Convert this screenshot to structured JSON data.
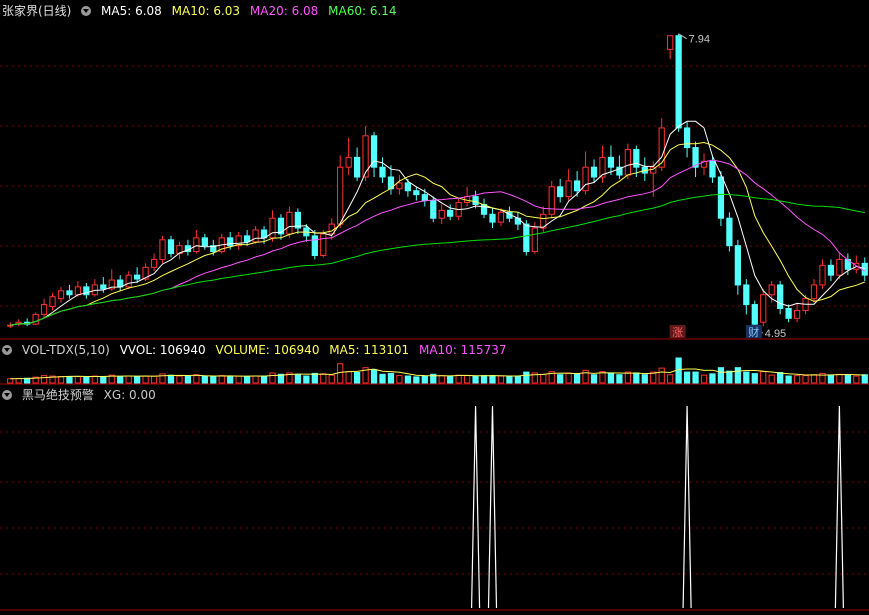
{
  "main": {
    "title": "张家界(日线)",
    "indicators": [
      {
        "label": "MA5: 6.08",
        "color": "#ffffff"
      },
      {
        "label": "MA10: 6.03",
        "color": "#ffff55"
      },
      {
        "label": "MA20: 6.08",
        "color": "#ff55ff"
      },
      {
        "label": "MA60: 6.14",
        "color": "#55ff55"
      }
    ],
    "high_label": "7.94",
    "low_label": "4.95",
    "marker_zhang": "涨",
    "marker_cai": "财"
  },
  "volume": {
    "title": "VOL-TDX(5,10)",
    "indicators": [
      {
        "label": "VVOL: 106940",
        "color": "#ffffff"
      },
      {
        "label": "VOLUME: 106940",
        "color": "#ffff55"
      },
      {
        "label": "MA5: 113101",
        "color": "#ffff55"
      },
      {
        "label": "MA10: 115737",
        "color": "#ff55ff"
      }
    ]
  },
  "signal": {
    "title": "黑马绝技预警",
    "indicators": [
      {
        "label": "XG: 0.00",
        "color": "#c8c8c8"
      }
    ]
  },
  "colors": {
    "up": "#ff3232",
    "down": "#54ffff",
    "ma5": "#ffffff",
    "ma10": "#ffff55",
    "ma20": "#ff55ff",
    "ma60": "#00e000",
    "grid": "#7a0000"
  },
  "chart_data": {
    "type": "candlestick",
    "y_range": [
      4.9,
      8.1
    ],
    "candles": [
      {
        "o": 4.98,
        "c": 4.99,
        "h": 5.02,
        "l": 4.96
      },
      {
        "o": 5.0,
        "c": 5.02,
        "h": 5.05,
        "l": 4.98
      },
      {
        "o": 5.02,
        "c": 5.0,
        "h": 5.06,
        "l": 4.98
      },
      {
        "o": 5.0,
        "c": 5.1,
        "h": 5.12,
        "l": 4.99
      },
      {
        "o": 5.1,
        "c": 5.2,
        "h": 5.26,
        "l": 5.06
      },
      {
        "o": 5.18,
        "c": 5.28,
        "h": 5.32,
        "l": 5.14
      },
      {
        "o": 5.26,
        "c": 5.34,
        "h": 5.38,
        "l": 5.22
      },
      {
        "o": 5.34,
        "c": 5.3,
        "h": 5.4,
        "l": 5.26
      },
      {
        "o": 5.3,
        "c": 5.38,
        "h": 5.44,
        "l": 5.28
      },
      {
        "o": 5.38,
        "c": 5.3,
        "h": 5.42,
        "l": 5.26
      },
      {
        "o": 5.3,
        "c": 5.4,
        "h": 5.46,
        "l": 5.28
      },
      {
        "o": 5.4,
        "c": 5.36,
        "h": 5.48,
        "l": 5.32
      },
      {
        "o": 5.36,
        "c": 5.45,
        "h": 5.56,
        "l": 5.34
      },
      {
        "o": 5.45,
        "c": 5.38,
        "h": 5.5,
        "l": 5.34
      },
      {
        "o": 5.38,
        "c": 5.5,
        "h": 5.54,
        "l": 5.36
      },
      {
        "o": 5.5,
        "c": 5.46,
        "h": 5.58,
        "l": 5.42
      },
      {
        "o": 5.46,
        "c": 5.58,
        "h": 5.62,
        "l": 5.44
      },
      {
        "o": 5.58,
        "c": 5.66,
        "h": 5.72,
        "l": 5.54
      },
      {
        "o": 5.66,
        "c": 5.86,
        "h": 5.9,
        "l": 5.62
      },
      {
        "o": 5.86,
        "c": 5.72,
        "h": 5.9,
        "l": 5.68
      },
      {
        "o": 5.72,
        "c": 5.8,
        "h": 5.84,
        "l": 5.66
      },
      {
        "o": 5.8,
        "c": 5.74,
        "h": 5.86,
        "l": 5.7
      },
      {
        "o": 5.74,
        "c": 5.88,
        "h": 5.96,
        "l": 5.72
      },
      {
        "o": 5.88,
        "c": 5.8,
        "h": 5.92,
        "l": 5.76
      },
      {
        "o": 5.8,
        "c": 5.74,
        "h": 5.86,
        "l": 5.7
      },
      {
        "o": 5.74,
        "c": 5.88,
        "h": 5.92,
        "l": 5.72
      },
      {
        "o": 5.88,
        "c": 5.8,
        "h": 5.94,
        "l": 5.76
      },
      {
        "o": 5.8,
        "c": 5.9,
        "h": 5.94,
        "l": 5.76
      },
      {
        "o": 5.9,
        "c": 5.84,
        "h": 5.96,
        "l": 5.8
      },
      {
        "o": 5.84,
        "c": 5.96,
        "h": 6.0,
        "l": 5.82
      },
      {
        "o": 5.96,
        "c": 5.88,
        "h": 6.0,
        "l": 5.82
      },
      {
        "o": 5.88,
        "c": 6.08,
        "h": 6.16,
        "l": 5.84
      },
      {
        "o": 6.08,
        "c": 5.92,
        "h": 6.12,
        "l": 5.86
      },
      {
        "o": 5.92,
        "c": 6.14,
        "h": 6.2,
        "l": 5.88
      },
      {
        "o": 6.14,
        "c": 5.98,
        "h": 6.18,
        "l": 5.92
      },
      {
        "o": 5.98,
        "c": 5.9,
        "h": 6.02,
        "l": 5.84
      },
      {
        "o": 5.9,
        "c": 5.7,
        "h": 5.96,
        "l": 5.66
      },
      {
        "o": 5.7,
        "c": 5.92,
        "h": 5.96,
        "l": 5.68
      },
      {
        "o": 5.92,
        "c": 6.02,
        "h": 6.08,
        "l": 5.86
      },
      {
        "o": 6.02,
        "c": 6.6,
        "h": 6.72,
        "l": 5.98
      },
      {
        "o": 6.6,
        "c": 6.7,
        "h": 6.9,
        "l": 6.52
      },
      {
        "o": 6.7,
        "c": 6.5,
        "h": 6.8,
        "l": 6.46
      },
      {
        "o": 6.5,
        "c": 6.92,
        "h": 7.02,
        "l": 6.46
      },
      {
        "o": 6.92,
        "c": 6.6,
        "h": 6.96,
        "l": 6.5
      },
      {
        "o": 6.6,
        "c": 6.5,
        "h": 6.7,
        "l": 6.44
      },
      {
        "o": 6.5,
        "c": 6.38,
        "h": 6.62,
        "l": 6.32
      },
      {
        "o": 6.38,
        "c": 6.44,
        "h": 6.52,
        "l": 6.32
      },
      {
        "o": 6.44,
        "c": 6.36,
        "h": 6.48,
        "l": 6.3
      },
      {
        "o": 6.36,
        "c": 6.32,
        "h": 6.4,
        "l": 6.26
      },
      {
        "o": 6.32,
        "c": 6.26,
        "h": 6.38,
        "l": 6.2
      },
      {
        "o": 6.26,
        "c": 6.08,
        "h": 6.3,
        "l": 6.04
      },
      {
        "o": 6.08,
        "c": 6.16,
        "h": 6.22,
        "l": 6.02
      },
      {
        "o": 6.16,
        "c": 6.1,
        "h": 6.22,
        "l": 6.06
      },
      {
        "o": 6.1,
        "c": 6.24,
        "h": 6.28,
        "l": 6.06
      },
      {
        "o": 6.24,
        "c": 6.3,
        "h": 6.4,
        "l": 6.2
      },
      {
        "o": 6.3,
        "c": 6.22,
        "h": 6.36,
        "l": 6.18
      },
      {
        "o": 6.22,
        "c": 6.12,
        "h": 6.28,
        "l": 6.08
      },
      {
        "o": 6.12,
        "c": 6.04,
        "h": 6.18,
        "l": 5.98
      },
      {
        "o": 6.04,
        "c": 6.14,
        "h": 6.18,
        "l": 6.0
      },
      {
        "o": 6.14,
        "c": 6.08,
        "h": 6.2,
        "l": 6.04
      },
      {
        "o": 6.08,
        "c": 6.02,
        "h": 6.14,
        "l": 5.96
      },
      {
        "o": 6.02,
        "c": 5.74,
        "h": 6.06,
        "l": 5.7
      },
      {
        "o": 5.74,
        "c": 5.98,
        "h": 6.04,
        "l": 5.72
      },
      {
        "o": 5.98,
        "c": 6.12,
        "h": 6.2,
        "l": 5.94
      },
      {
        "o": 6.12,
        "c": 6.4,
        "h": 6.46,
        "l": 6.08
      },
      {
        "o": 6.4,
        "c": 6.3,
        "h": 6.48,
        "l": 6.24
      },
      {
        "o": 6.3,
        "c": 6.46,
        "h": 6.58,
        "l": 6.26
      },
      {
        "o": 6.46,
        "c": 6.36,
        "h": 6.56,
        "l": 6.3
      },
      {
        "o": 6.36,
        "c": 6.6,
        "h": 6.76,
        "l": 6.32
      },
      {
        "o": 6.6,
        "c": 6.5,
        "h": 6.68,
        "l": 6.44
      },
      {
        "o": 6.5,
        "c": 6.7,
        "h": 6.82,
        "l": 6.44
      },
      {
        "o": 6.7,
        "c": 6.6,
        "h": 6.82,
        "l": 6.52
      },
      {
        "o": 6.6,
        "c": 6.52,
        "h": 6.72,
        "l": 6.48
      },
      {
        "o": 6.52,
        "c": 6.78,
        "h": 6.84,
        "l": 6.48
      },
      {
        "o": 6.78,
        "c": 6.6,
        "h": 6.82,
        "l": 6.5
      },
      {
        "o": 6.6,
        "c": 6.54,
        "h": 6.7,
        "l": 6.46
      },
      {
        "o": 6.54,
        "c": 6.6,
        "h": 6.66,
        "l": 6.3
      },
      {
        "o": 6.6,
        "c": 7.0,
        "h": 7.1,
        "l": 6.56
      },
      {
        "o": 7.8,
        "c": 7.94,
        "h": 7.94,
        "l": 7.7
      },
      {
        "o": 7.94,
        "c": 7.0,
        "h": 7.96,
        "l": 6.96
      },
      {
        "o": 7.0,
        "c": 6.8,
        "h": 7.06,
        "l": 6.7
      },
      {
        "o": 6.8,
        "c": 6.6,
        "h": 6.86,
        "l": 6.5
      },
      {
        "o": 6.6,
        "c": 6.66,
        "h": 6.74,
        "l": 6.52
      },
      {
        "o": 6.66,
        "c": 6.5,
        "h": 6.72,
        "l": 6.44
      },
      {
        "o": 6.5,
        "c": 6.08,
        "h": 6.56,
        "l": 6.0
      },
      {
        "o": 6.08,
        "c": 5.8,
        "h": 6.14,
        "l": 5.74
      },
      {
        "o": 5.8,
        "c": 5.4,
        "h": 5.86,
        "l": 5.3
      },
      {
        "o": 5.4,
        "c": 5.2,
        "h": 5.46,
        "l": 5.1
      },
      {
        "o": 5.2,
        "c": 5.0,
        "h": 5.24,
        "l": 4.95
      },
      {
        "o": 5.02,
        "c": 5.3,
        "h": 5.36,
        "l": 4.98
      },
      {
        "o": 5.3,
        "c": 5.4,
        "h": 5.44,
        "l": 5.22
      },
      {
        "o": 5.4,
        "c": 5.16,
        "h": 5.44,
        "l": 5.1
      },
      {
        "o": 5.16,
        "c": 5.06,
        "h": 5.2,
        "l": 5.02
      },
      {
        "o": 5.06,
        "c": 5.14,
        "h": 5.22,
        "l": 5.02
      },
      {
        "o": 5.14,
        "c": 5.26,
        "h": 5.3,
        "l": 5.1
      },
      {
        "o": 5.26,
        "c": 5.4,
        "h": 5.46,
        "l": 5.22
      },
      {
        "o": 5.4,
        "c": 5.6,
        "h": 5.66,
        "l": 5.36
      },
      {
        "o": 5.6,
        "c": 5.5,
        "h": 5.66,
        "l": 5.44
      },
      {
        "o": 5.5,
        "c": 5.66,
        "h": 5.72,
        "l": 5.46
      },
      {
        "o": 5.66,
        "c": 5.56,
        "h": 5.72,
        "l": 5.5
      },
      {
        "o": 5.56,
        "c": 5.62,
        "h": 5.7,
        "l": 5.52
      },
      {
        "o": 5.62,
        "c": 5.5,
        "h": 5.68,
        "l": 5.44
      }
    ],
    "ma60_last": 6.14,
    "signal_peaks": [
      55,
      57,
      80,
      98
    ]
  }
}
